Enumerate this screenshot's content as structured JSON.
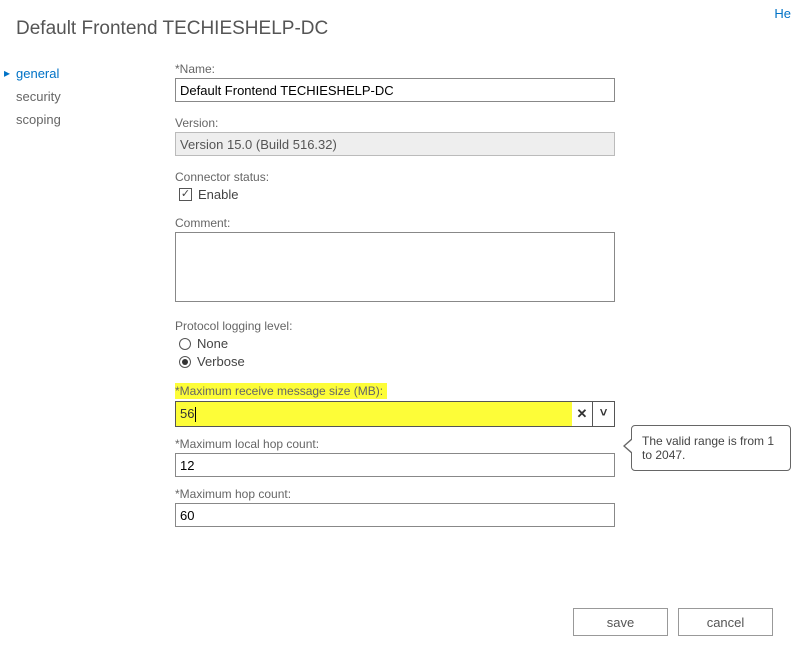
{
  "header": {
    "title": "Default Frontend TECHIESHELP-DC",
    "help": "He"
  },
  "sidebar": {
    "items": [
      {
        "label": "general"
      },
      {
        "label": "security"
      },
      {
        "label": "scoping"
      }
    ]
  },
  "form": {
    "name_label": "*Name:",
    "name_value": "Default Frontend TECHIESHELP-DC",
    "version_label": "Version:",
    "version_value": "Version 15.0 (Build 516.32)",
    "connstatus_label": "Connector status:",
    "enable_label": "Enable",
    "enable_checked": "✓",
    "comment_label": "Comment:",
    "comment_value": "",
    "loglevel_label": "Protocol logging level:",
    "radio_none": "None",
    "radio_verbose": "Verbose",
    "maxrecv_label": "*Maximum receive message size (MB):",
    "maxrecv_value": "56",
    "combo_clear": "✕",
    "combo_drop": "˅",
    "maxlocalhop_label": "*Maximum local hop count:",
    "maxlocalhop_value": "12",
    "maxhop_label": "*Maximum hop count:",
    "maxhop_value": "60"
  },
  "callout": {
    "text": "The valid range is from 1 to 2047."
  },
  "footer": {
    "save": "save",
    "cancel": "cancel"
  }
}
